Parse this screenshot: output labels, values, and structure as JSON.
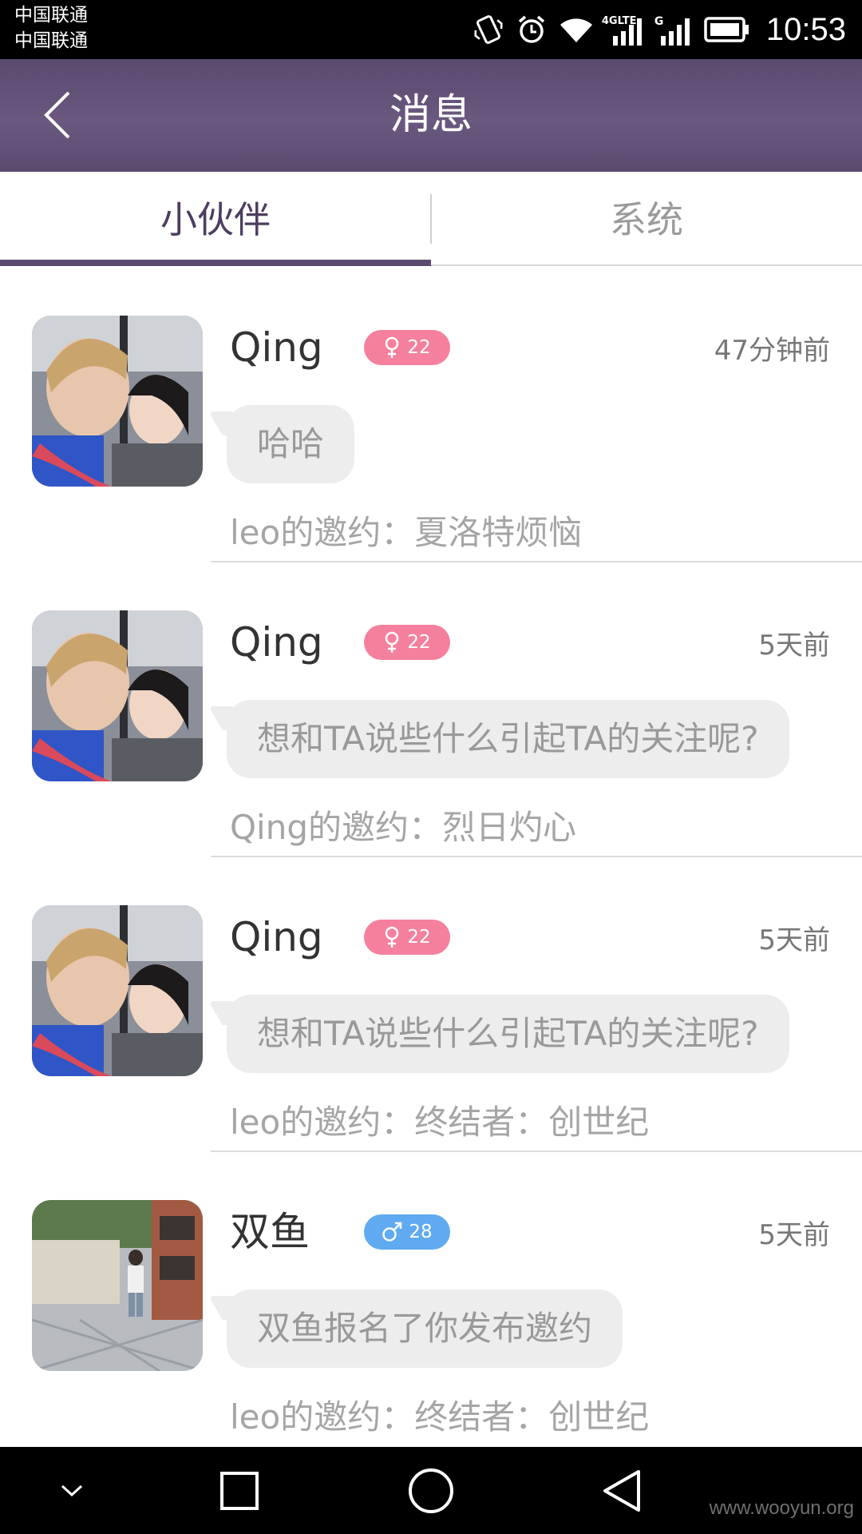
{
  "status_bar": {
    "carrier_1": "中国联通",
    "carrier_2": "中国联通",
    "net_4g_label": "4GLTE",
    "net_g_label": "G",
    "time": "10:53"
  },
  "header": {
    "title": "消息"
  },
  "tabs": [
    {
      "label": "小伙伴",
      "active": true
    },
    {
      "label": "系统",
      "active": false
    }
  ],
  "messages": [
    {
      "name": "Qing",
      "gender_icon": "female-icon",
      "age": "22",
      "time": "47分钟前",
      "bubble": "哈哈",
      "invite": "leo的邀约：夏洛特烦恼"
    },
    {
      "name": "Qing",
      "gender_icon": "female-icon",
      "age": "22",
      "time": "5天前",
      "bubble": "想和TA说些什么引起TA的关注呢?",
      "invite": "Qing的邀约：烈日灼心"
    },
    {
      "name": "Qing",
      "gender_icon": "female-icon",
      "age": "22",
      "time": "5天前",
      "bubble": "想和TA说些什么引起TA的关注呢?",
      "invite": "leo的邀约：终结者：创世纪"
    },
    {
      "name": "双鱼",
      "gender_icon": "male-icon",
      "age": "28",
      "time": "5天前",
      "bubble": "双鱼报名了你发布邀约",
      "invite": "leo的邀约：终结者：创世纪"
    }
  ],
  "watermark": "www.wooyun.org",
  "colors": {
    "header": "#5b4b6f",
    "female_badge": "#f5809e",
    "male_badge": "#5faaf0"
  }
}
